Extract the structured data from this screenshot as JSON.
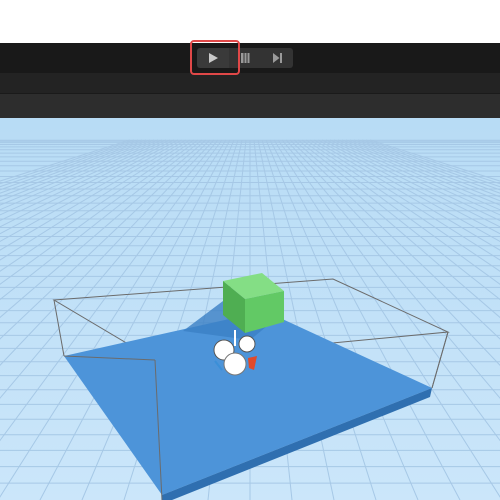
{
  "toolbar": {
    "play_button": {
      "icon": "play-icon"
    },
    "pause_button": {
      "icon": "pause-icon"
    },
    "step_button": {
      "icon": "step-forward-icon"
    },
    "highlighted_control": "play-button"
  },
  "scene": {
    "background_color": "#c2e1f7",
    "grid_color": "#a6c8e6",
    "plane_color": "#4d94d9",
    "plane_edge_color": "#2f6fb0",
    "cube_color": "#62c965",
    "bounds_color": "#6b6b6b"
  },
  "colors": {
    "toolbar_bg": "#191919",
    "highlight": "#e04848"
  }
}
